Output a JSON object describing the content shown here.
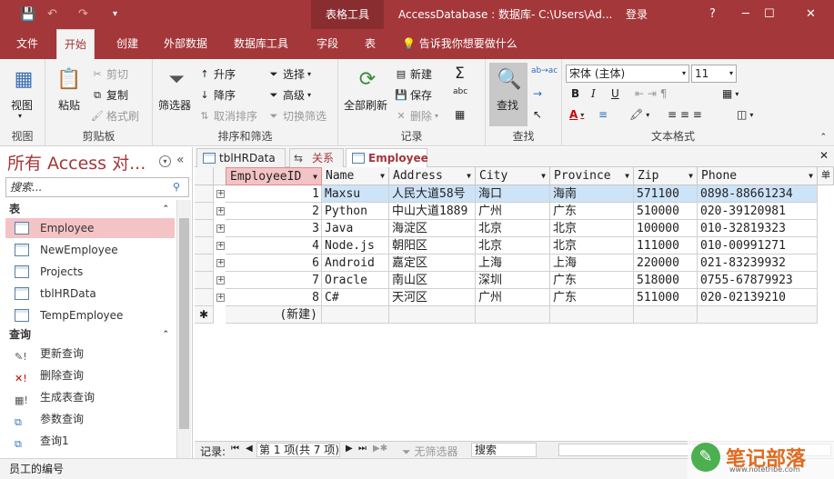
{
  "titlebar": {
    "context_tab": "表格工具",
    "title": "AccessDatabase : 数据库- C:\\Users\\Ad...",
    "login": "登录",
    "help": "?",
    "minimize": "─",
    "restore": "☐",
    "close": "✕",
    "undo": "↶",
    "redo": "↷",
    "more": "▾"
  },
  "tabs": [
    {
      "label": "文件"
    },
    {
      "label": "开始"
    },
    {
      "label": "创建"
    },
    {
      "label": "外部数据"
    },
    {
      "label": "数据库工具"
    },
    {
      "label": "字段"
    },
    {
      "label": "表"
    }
  ],
  "tellme": "告诉我你想要做什么",
  "ribbon": {
    "view": {
      "label": "视图",
      "group": "视图"
    },
    "clipboard": {
      "paste": "粘贴",
      "cut": "剪切",
      "copy": "复制",
      "format_painter": "格式刷",
      "group": "剪贴板"
    },
    "sort": {
      "filter": "筛选器",
      "asc": "升序",
      "desc": "降序",
      "clear_sort": "取消排序",
      "selection": "选择",
      "advanced": "高级",
      "toggle_filter": "切换筛选",
      "group": "排序和筛选"
    },
    "records": {
      "refresh": "全部刷新",
      "new": "新建",
      "save": "保存",
      "delete": "删除",
      "sigma": "Σ",
      "spell": "abc",
      "more": "▦",
      "group": "记录"
    },
    "find": {
      "find": "查找",
      "replace": "ab→ac",
      "goto": "→",
      "select": "↖",
      "group": "查找"
    },
    "text": {
      "font": "宋体 (主体)",
      "size": "11",
      "bold": "B",
      "italic": "I",
      "underline": "U",
      "group": "文本格式"
    }
  },
  "nav": {
    "title": "所有 Access 对...",
    "search_placeholder": "搜索...",
    "section_tables": "表",
    "tables": [
      {
        "label": "Employee",
        "selected": true
      },
      {
        "label": "NewEmployee"
      },
      {
        "label": "Projects"
      },
      {
        "label": "tblHRData"
      },
      {
        "label": "TempEmployee"
      }
    ],
    "section_queries": "查询",
    "queries": [
      {
        "label": "更新查询",
        "icon": "update-query-icon"
      },
      {
        "label": "删除查询",
        "icon": "delete-query-icon"
      },
      {
        "label": "生成表查询",
        "icon": "make-table-query-icon"
      },
      {
        "label": "参数查询",
        "icon": "parameter-query-icon"
      },
      {
        "label": "查询1",
        "icon": "select-query-icon"
      }
    ]
  },
  "doc_tabs": [
    {
      "label": "tblHRData"
    },
    {
      "label": "关系"
    },
    {
      "label": "Employee",
      "active": true
    }
  ],
  "table": {
    "columns": [
      "EmployeeID",
      "Name",
      "Address",
      "City",
      "Province",
      "Zip",
      "Phone"
    ],
    "rows": [
      [
        "1",
        "Maxsu",
        "人民大道58号",
        "海口",
        "海南",
        "571100",
        "0898-88661234"
      ],
      [
        "2",
        "Python",
        "中山大道1889",
        "广州",
        "广东",
        "510000",
        "020-39120981"
      ],
      [
        "3",
        "Java",
        "海淀区",
        "北京",
        "北京",
        "100000",
        "010-32819323"
      ],
      [
        "4",
        "Node.js",
        "朝阳区",
        "北京",
        "北京",
        "111000",
        "010-00991271"
      ],
      [
        "6",
        "Android",
        "嘉定区",
        "上海",
        "上海",
        "220000",
        "021-83239932"
      ],
      [
        "7",
        "Oracle",
        "南山区",
        "深圳",
        "广东",
        "518000",
        "0755-67879923"
      ],
      [
        "8",
        "C#",
        "天河区",
        "广州",
        "广东",
        "511000",
        "020-02139210"
      ]
    ],
    "new_row": "(新建)",
    "new_marker": "✱"
  },
  "recordbar": {
    "label": "记录:",
    "position": "第 1 项(共 7 项)",
    "no_filter": "无筛选器",
    "search": "搜索"
  },
  "status": "员工的编号",
  "watermark": {
    "text": "笔记部落",
    "sub": "www.notetribe.com"
  },
  "colors": {
    "accent": "#a4373a",
    "selection": "#f4c3c5",
    "row_select": "#cde3f7"
  }
}
